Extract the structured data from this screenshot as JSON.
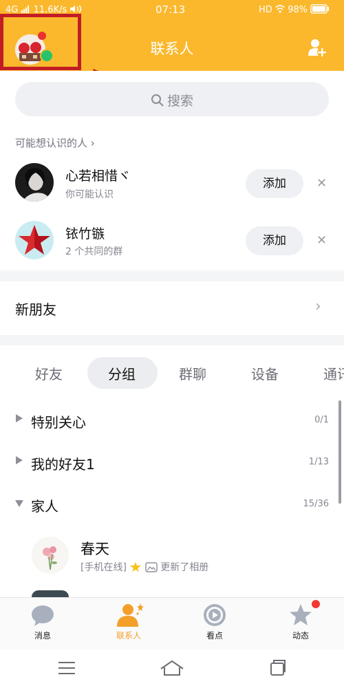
{
  "status_bar": {
    "network": "4G",
    "speed": "11.6K/s",
    "time": "07:13",
    "hd": "HD",
    "battery": "98%"
  },
  "header": {
    "title": "联系人",
    "add_icon": "add-contact-icon"
  },
  "search": {
    "placeholder": "搜索",
    "icon": "search-icon"
  },
  "suggested": {
    "section_label": "可能想认识的人 ›",
    "people": [
      {
        "name": "心若相惜ヾ",
        "subtitle": "你可能认识",
        "add_label": "添加"
      },
      {
        "name": "铱竹镞",
        "subtitle": "2 个共同的群",
        "add_label": "添加"
      }
    ]
  },
  "new_friends": {
    "label": "新朋友"
  },
  "tabs": [
    "好友",
    "分组",
    "群聊",
    "设备",
    "通讯"
  ],
  "active_tab": "分组",
  "groups": [
    {
      "name": "特别关心",
      "count": "0/1",
      "expanded": false
    },
    {
      "name": "我的好友1",
      "count": "1/13",
      "expanded": false
    },
    {
      "name": "家人",
      "count": "15/36",
      "expanded": true
    }
  ],
  "contact": {
    "name": "春天",
    "status": "[手机在线]",
    "activity": "更新了相册"
  },
  "bottom_nav": [
    {
      "label": "消息",
      "icon": "chat-bubble-icon"
    },
    {
      "label": "联系人",
      "icon": "contacts-person-icon"
    },
    {
      "label": "看点",
      "icon": "play-circle-icon"
    },
    {
      "label": "动态",
      "icon": "star-icon"
    }
  ],
  "colors": {
    "accent": "#fbb82d",
    "highlight_box": "#c21d24",
    "online": "#27c36a"
  }
}
